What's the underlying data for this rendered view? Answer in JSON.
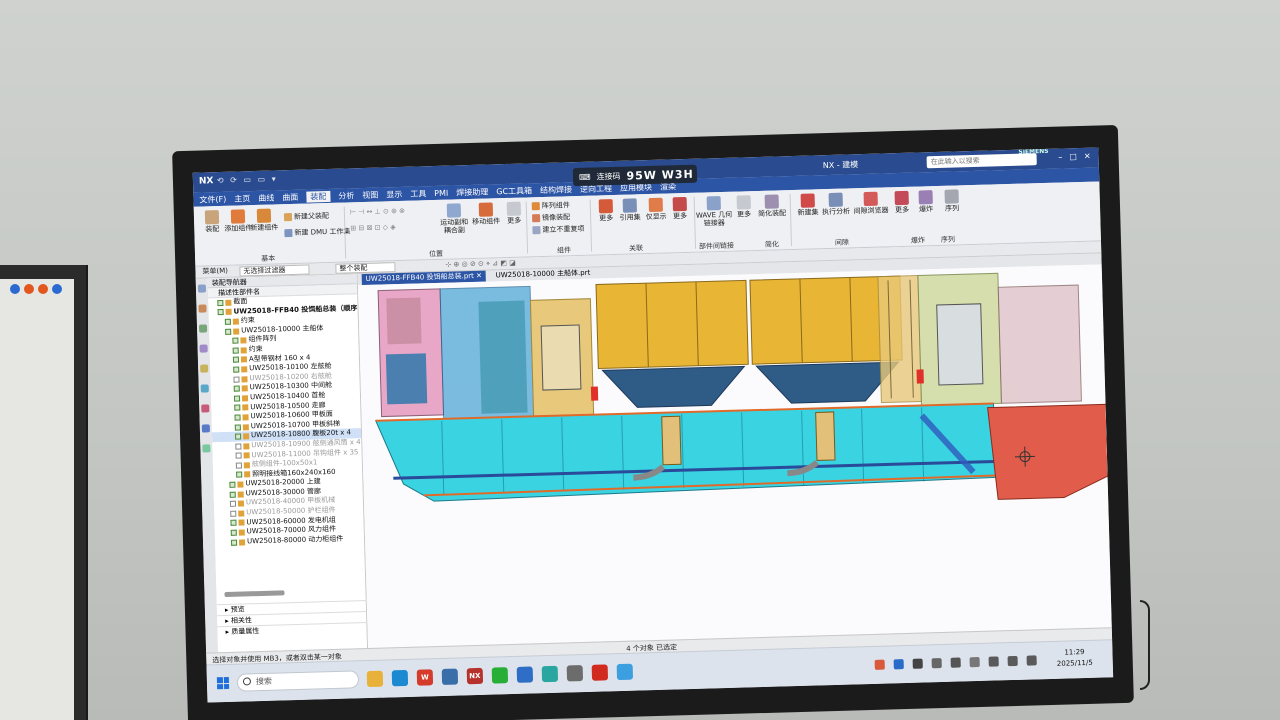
{
  "window": {
    "app_logo": "NX",
    "title": "NX - 建模",
    "search_placeholder": "在此输入以搜索",
    "vendor": "SIEMENS",
    "controls": [
      "–",
      "□",
      "✕"
    ]
  },
  "connection_overlay": {
    "label": "连接码",
    "code": "95W W3H"
  },
  "menu": [
    "文件(F)",
    "主页",
    "曲线",
    "曲面",
    "装配",
    "分析",
    "视图",
    "显示",
    "工具",
    "PMI",
    "焊接助理",
    "GC工具箱",
    "结构焊接",
    "逆向工程",
    "应用模块",
    "渲染"
  ],
  "menu_active_index": 4,
  "ribbon": {
    "basic": {
      "label": "基本",
      "buttons": [
        "装配",
        "添加组件",
        "新建组件"
      ],
      "small": [
        "新建父装配",
        "新建 DMU 工作集"
      ]
    },
    "position": {
      "label": "位置",
      "buttons": [
        "运动副和耦合副",
        "移动组件",
        "更多"
      ]
    },
    "component": {
      "label": "组件",
      "small": [
        "阵列组件",
        "镜像装配",
        "建立不重复项"
      ]
    },
    "association": {
      "label": "关联",
      "buttons": [
        "更多",
        "引用集",
        "仅显示",
        "更多"
      ]
    },
    "interpart": {
      "label": "部件间链接",
      "buttons": [
        "WAVE 几何链接器",
        "更多"
      ]
    },
    "simplify": {
      "label": "简化",
      "buttons": [
        "简化装配"
      ]
    },
    "clearance": {
      "label": "间隙",
      "buttons": [
        "新建集",
        "执行分析",
        "间隙浏览器",
        "更多"
      ]
    },
    "explode": {
      "label": "爆炸",
      "buttons": [
        "爆炸"
      ]
    },
    "sequence": {
      "label": "序列",
      "buttons": [
        "序列"
      ]
    }
  },
  "filterbar": {
    "menu": "菜单(M)",
    "filter": "无选择过滤器",
    "scope": "整个装配"
  },
  "navigator": {
    "title": "装配导航器",
    "column": "描述性部件名",
    "items": [
      {
        "text": "截面",
        "indent": 1,
        "grey": false
      },
      {
        "text": "UW25018-FFB40 投饵船总装（顺序:",
        "indent": 1,
        "bold": true
      },
      {
        "text": "约束",
        "indent": 2
      },
      {
        "text": "UW25018-10000 主船体",
        "indent": 2
      },
      {
        "text": "组件阵列",
        "indent": 3
      },
      {
        "text": "约束",
        "indent": 3
      },
      {
        "text": "A型带钢材 160 x 4",
        "indent": 3
      },
      {
        "text": "UW25018-10100 左舷舱",
        "indent": 3
      },
      {
        "text": "UW25018-10200 右舷舱",
        "indent": 3,
        "grey": true
      },
      {
        "text": "UW25018-10300 中间舱",
        "indent": 3
      },
      {
        "text": "UW25018-10400 首舱",
        "indent": 3
      },
      {
        "text": "UW25018-10500 走廊",
        "indent": 3
      },
      {
        "text": "UW25018-10600 甲板面",
        "indent": 3
      },
      {
        "text": "UW25018-10700 甲板斜梯",
        "indent": 3
      },
      {
        "text": "UW25018-10800 腹板20t x 4",
        "indent": 3,
        "sel": true
      },
      {
        "text": "UW25018-10900 舷侧通风筒 x 4",
        "indent": 3,
        "grey": true
      },
      {
        "text": "UW25018-11000 吊钩组件 x 35",
        "indent": 3,
        "grey": true
      },
      {
        "text": "舷侧组件-100x50x1",
        "indent": 3,
        "grey": true
      },
      {
        "text": "照明接线箱160x240x160",
        "indent": 3
      },
      {
        "text": "UW25018-20000 上建",
        "indent": 2
      },
      {
        "text": "UW25018-30000 管廊",
        "indent": 2
      },
      {
        "text": "UW25018-40000 甲板机械",
        "indent": 2,
        "grey": true
      },
      {
        "text": "UW25018-50000 护栏组件",
        "indent": 2,
        "grey": true
      },
      {
        "text": "UW25018-60000 发电机组",
        "indent": 2
      },
      {
        "text": "UW25018-70000 风力组件",
        "indent": 2
      },
      {
        "text": "UW25018-80000 动力柜组件",
        "indent": 2
      }
    ],
    "panels": [
      "预览",
      "相关性",
      "质量属性"
    ]
  },
  "doc_tabs": [
    "UW25018-FFB40 投饵船总装.prt",
    "UW25018-10000 主船体.prt"
  ],
  "status": {
    "prompt": "选择对象并使用 MB3，或者双击某一对象",
    "selection": "4 个对象 已选定"
  },
  "taskbar": {
    "search_placeholder": "搜索",
    "apps": [
      {
        "name": "file-explorer",
        "color": "#e8b23a",
        "label": ""
      },
      {
        "name": "edge",
        "color": "#1b8ad1",
        "label": ""
      },
      {
        "name": "wps",
        "color": "#d43b2b",
        "label": "W"
      },
      {
        "name": "tool",
        "color": "#3a6ea8",
        "label": ""
      },
      {
        "name": "nx",
        "color": "#b7312c",
        "label": "NX"
      },
      {
        "name": "wechat",
        "color": "#27ae36",
        "label": ""
      },
      {
        "name": "app-blue",
        "color": "#2f6ec6",
        "label": ""
      },
      {
        "name": "app-teal",
        "color": "#2aa6a0",
        "label": ""
      },
      {
        "name": "app-star",
        "color": "#6c6c6c",
        "label": ""
      },
      {
        "name": "acrobat",
        "color": "#d12a1f",
        "label": ""
      },
      {
        "name": "app-cloud",
        "color": "#3b9fe0",
        "label": ""
      }
    ],
    "time": "11:29",
    "date": "2025/11/5"
  },
  "colors": {
    "titlebar": "#2a4b8f",
    "ribbon_tab": "#2d55a6",
    "hull_cyan": "#3ad3e2",
    "tank_yellow": "#e8b534",
    "bow_red": "#e25c4c",
    "pink_deck": "#e9a7c7"
  }
}
